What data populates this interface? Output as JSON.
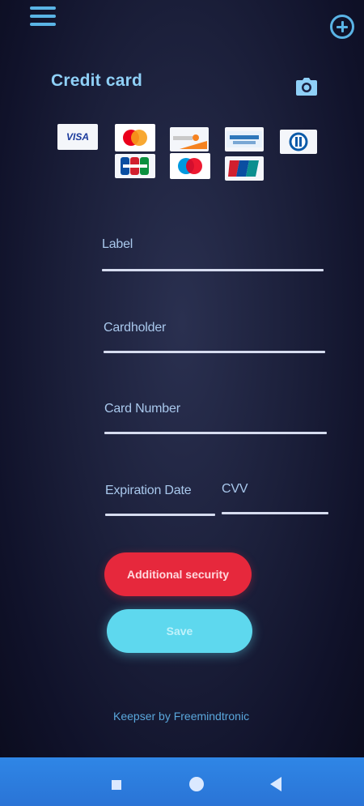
{
  "header": {
    "title": "Credit card"
  },
  "icons": {
    "menu": "hamburger-menu-icon",
    "add": "plus-circle-icon",
    "camera": "camera-icon"
  },
  "card_types": {
    "visa_text": "VISA"
  },
  "form": {
    "label_field": {
      "label": "Label",
      "value": ""
    },
    "cardholder_field": {
      "label": "Cardholder",
      "value": ""
    },
    "card_number_field": {
      "label": "Card Number",
      "value": ""
    },
    "expiration_field": {
      "label": "Expiration Date",
      "value": ""
    },
    "cvv_field": {
      "label": "CVV",
      "value": ""
    }
  },
  "buttons": {
    "additional_security": "Additional security",
    "save": "Save"
  },
  "footer": {
    "text": "Keepser by Freemindtronic"
  },
  "colors": {
    "accent": "#5ab4e6",
    "title": "#8fd0f7",
    "security_button": "#e6283c",
    "save_button": "#5ed8ee",
    "nav_bar": "#2f86e6"
  }
}
